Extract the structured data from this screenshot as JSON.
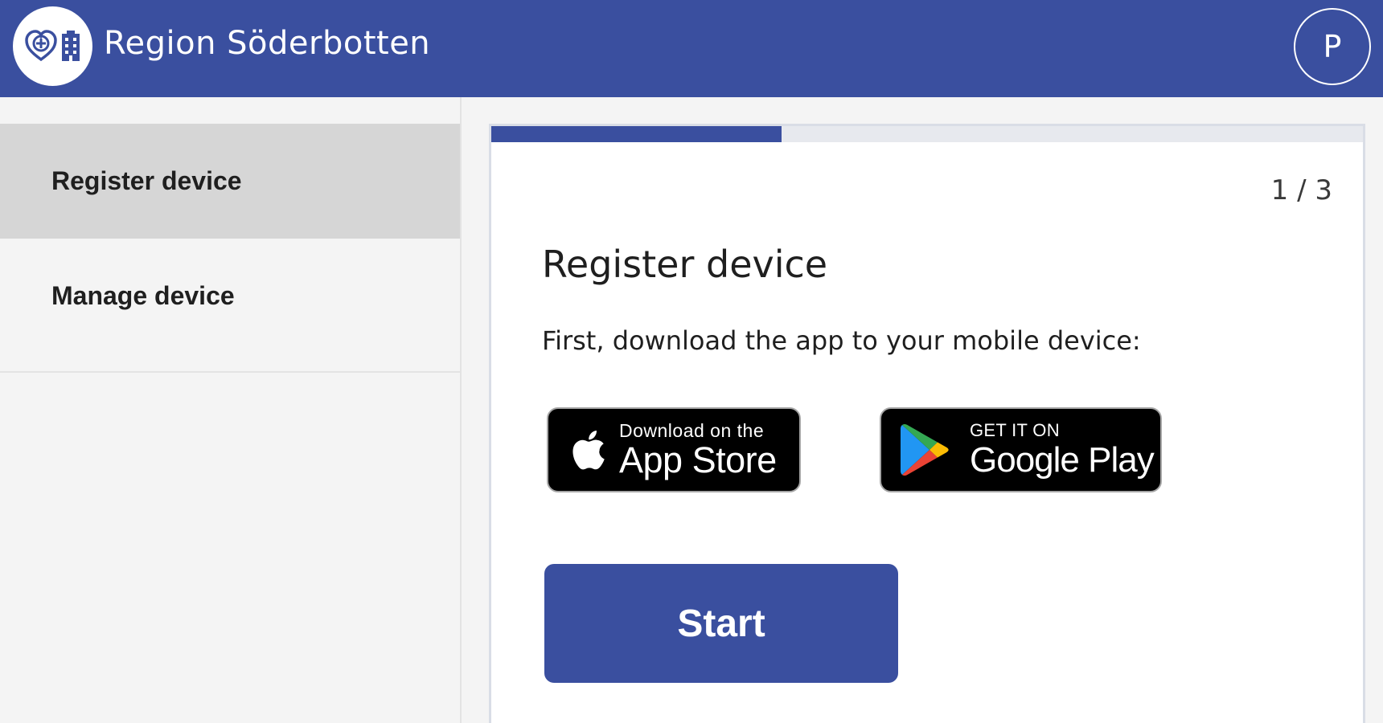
{
  "header": {
    "title": "Region Söderbotten",
    "logo_icons": [
      "heart-plus-icon",
      "building-icon"
    ],
    "avatar_initial": "P",
    "background_color": "#3a4f9f"
  },
  "sidebar": {
    "items": [
      {
        "label": "Register device",
        "active": true
      },
      {
        "label": "Manage device",
        "active": false
      }
    ]
  },
  "wizard": {
    "progress_fraction": 0.333,
    "step_counter": "1 / 3",
    "title": "Register device",
    "instruction": "First, download the app to your mobile device:",
    "app_store": {
      "line1": "Download on the",
      "line2": "App Store",
      "icon": "apple-icon"
    },
    "google_play": {
      "line1": "GET IT ON",
      "line2": "Google Play",
      "icon": "google-play-icon"
    },
    "start_label": "Start"
  }
}
